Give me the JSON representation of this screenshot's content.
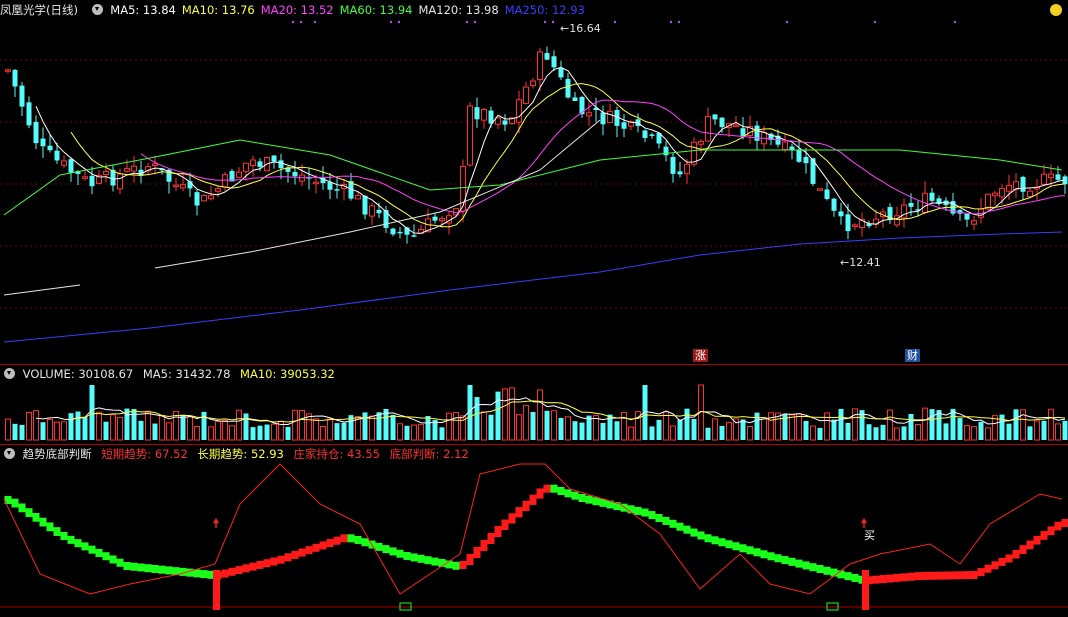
{
  "price_panel": {
    "stock_name": "凤凰光学(日线)",
    "ma": [
      {
        "label": "MA5: 13.84",
        "color": "#ffffff"
      },
      {
        "label": "MA10: 13.76",
        "color": "#ffff40"
      },
      {
        "label": "MA20: 13.52",
        "color": "#ff40ff"
      },
      {
        "label": "MA60: 13.94",
        "color": "#40ff40"
      },
      {
        "label": "MA120: 13.98",
        "color": "#e6e6e6"
      },
      {
        "label": "MA250: 12.93",
        "color": "#3c3cff"
      }
    ],
    "high_label": "16.64",
    "low_label": "12.41",
    "tag_zhang": "涨",
    "tag_cai": "财",
    "icon": "sun-icon"
  },
  "volume_panel": {
    "title": "VOLUME: 30108.67",
    "ma5": "MA5: 31432.78",
    "ma10": "MA10: 39053.32"
  },
  "indicator_panel": {
    "name": "趋势底部判断",
    "short_trend": "短期趋势: 67.52",
    "long_trend": "长期趋势: 52.93",
    "holding": "庄家持仓: 43.55",
    "bottom": "底部判断: 2.12",
    "buy_label": "买"
  },
  "colors": {
    "up": "#ff3232",
    "down": "#54fcfc",
    "grid_red": "#b00000"
  }
}
